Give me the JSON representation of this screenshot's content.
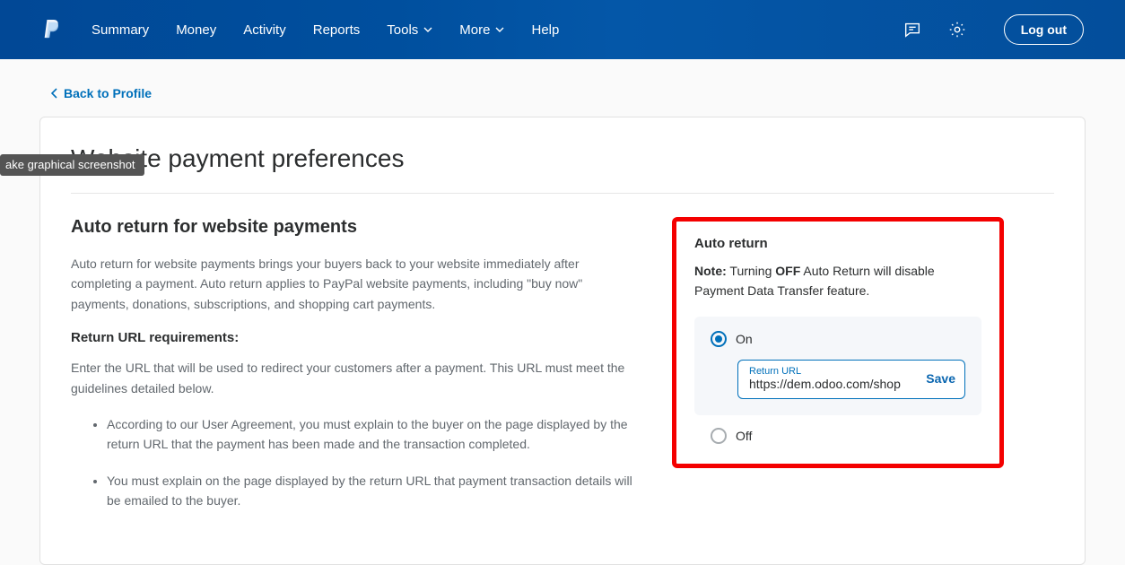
{
  "nav": {
    "summary": "Summary",
    "money": "Money",
    "activity": "Activity",
    "reports": "Reports",
    "tools": "Tools",
    "more": "More",
    "help": "Help",
    "logout": "Log out"
  },
  "tooltip": "ake graphical screenshot",
  "breadcrumb": {
    "back": "Back to Profile"
  },
  "page": {
    "title": "Website payment preferences"
  },
  "left": {
    "h2": "Auto return for website payments",
    "p1": "Auto return for website payments brings your buyers back to your website immediately after completing a payment. Auto return applies to PayPal website payments, including \"buy now\" payments, donations, subscriptions, and shopping cart payments.",
    "h3": "Return URL requirements:",
    "p2": "Enter the URL that will be used to redirect your customers after a payment. This URL must meet the guidelines detailed below.",
    "li1": "According to our User Agreement, you must explain to the buyer on the page displayed by the return URL that the payment has been made and the transaction completed.",
    "li2": "You must explain on the page displayed by the return URL that payment transaction details will be emailed to the buyer."
  },
  "right": {
    "heading": "Auto return",
    "note_label": "Note:",
    "note_pre": " Turning ",
    "note_off": "OFF",
    "note_post": " Auto Return will disable Payment Data Transfer feature.",
    "on": "On",
    "off": "Off",
    "url_label": "Return URL",
    "url_value": "https://dem.odoo.com/shop",
    "save": "Save"
  }
}
